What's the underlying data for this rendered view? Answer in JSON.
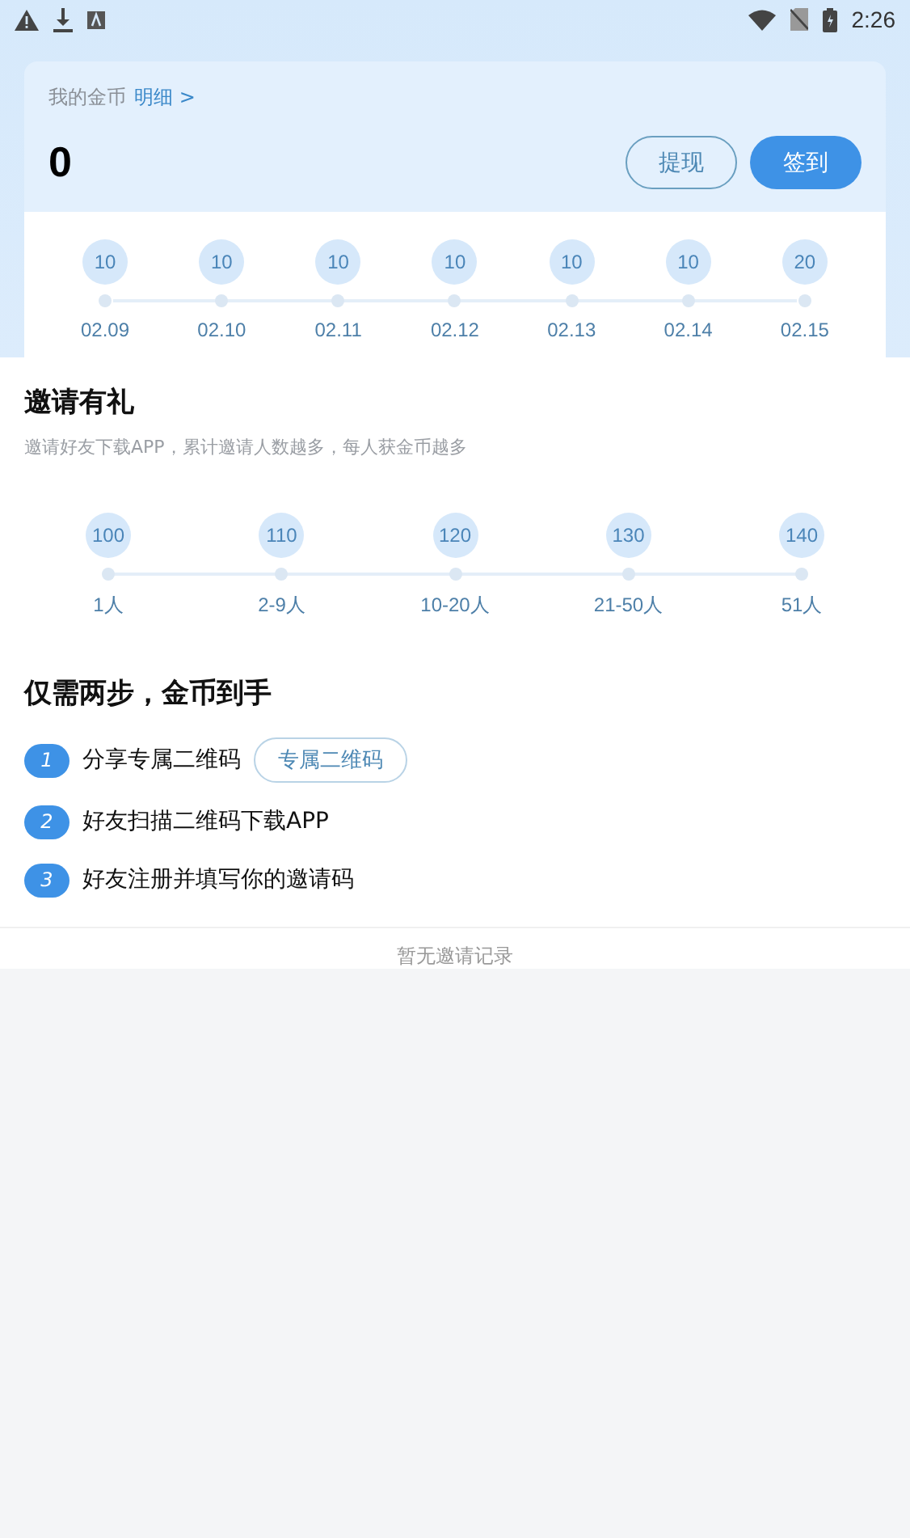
{
  "status_bar": {
    "time": "2:26"
  },
  "coins": {
    "label": "我的金币",
    "detail_link": "明细 >",
    "amount": "0",
    "buttons": [
      {
        "label": "提现",
        "kind": "outline"
      },
      {
        "label": "签到",
        "kind": "filled"
      }
    ]
  },
  "checkin_days": [
    {
      "reward": "10",
      "date": "02.09"
    },
    {
      "reward": "10",
      "date": "02.10"
    },
    {
      "reward": "10",
      "date": "02.11"
    },
    {
      "reward": "10",
      "date": "02.12"
    },
    {
      "reward": "10",
      "date": "02.13"
    },
    {
      "reward": "10",
      "date": "02.14"
    },
    {
      "reward": "20",
      "date": "02.15"
    }
  ],
  "invite": {
    "title": "邀请有礼",
    "subtitle": "邀请好友下载APP，累计邀请人数越多，每人获金币越多",
    "tiers": [
      {
        "reward": "100",
        "people": "1人"
      },
      {
        "reward": "110",
        "people": "2-9人"
      },
      {
        "reward": "120",
        "people": "10-20人"
      },
      {
        "reward": "130",
        "people": "21-50人"
      },
      {
        "reward": "140",
        "people": "51人"
      }
    ]
  },
  "steps": {
    "title": "仅需两步，金币到手",
    "items": [
      {
        "number": "1",
        "text": "分享专属二维码",
        "button": "专属二维码"
      },
      {
        "number": "2",
        "text": "好友扫描二维码下载APP"
      },
      {
        "number": "3",
        "text": "好友注册并填写你的邀请码"
      }
    ]
  },
  "records": {
    "empty_text": "暂无邀请记录"
  }
}
